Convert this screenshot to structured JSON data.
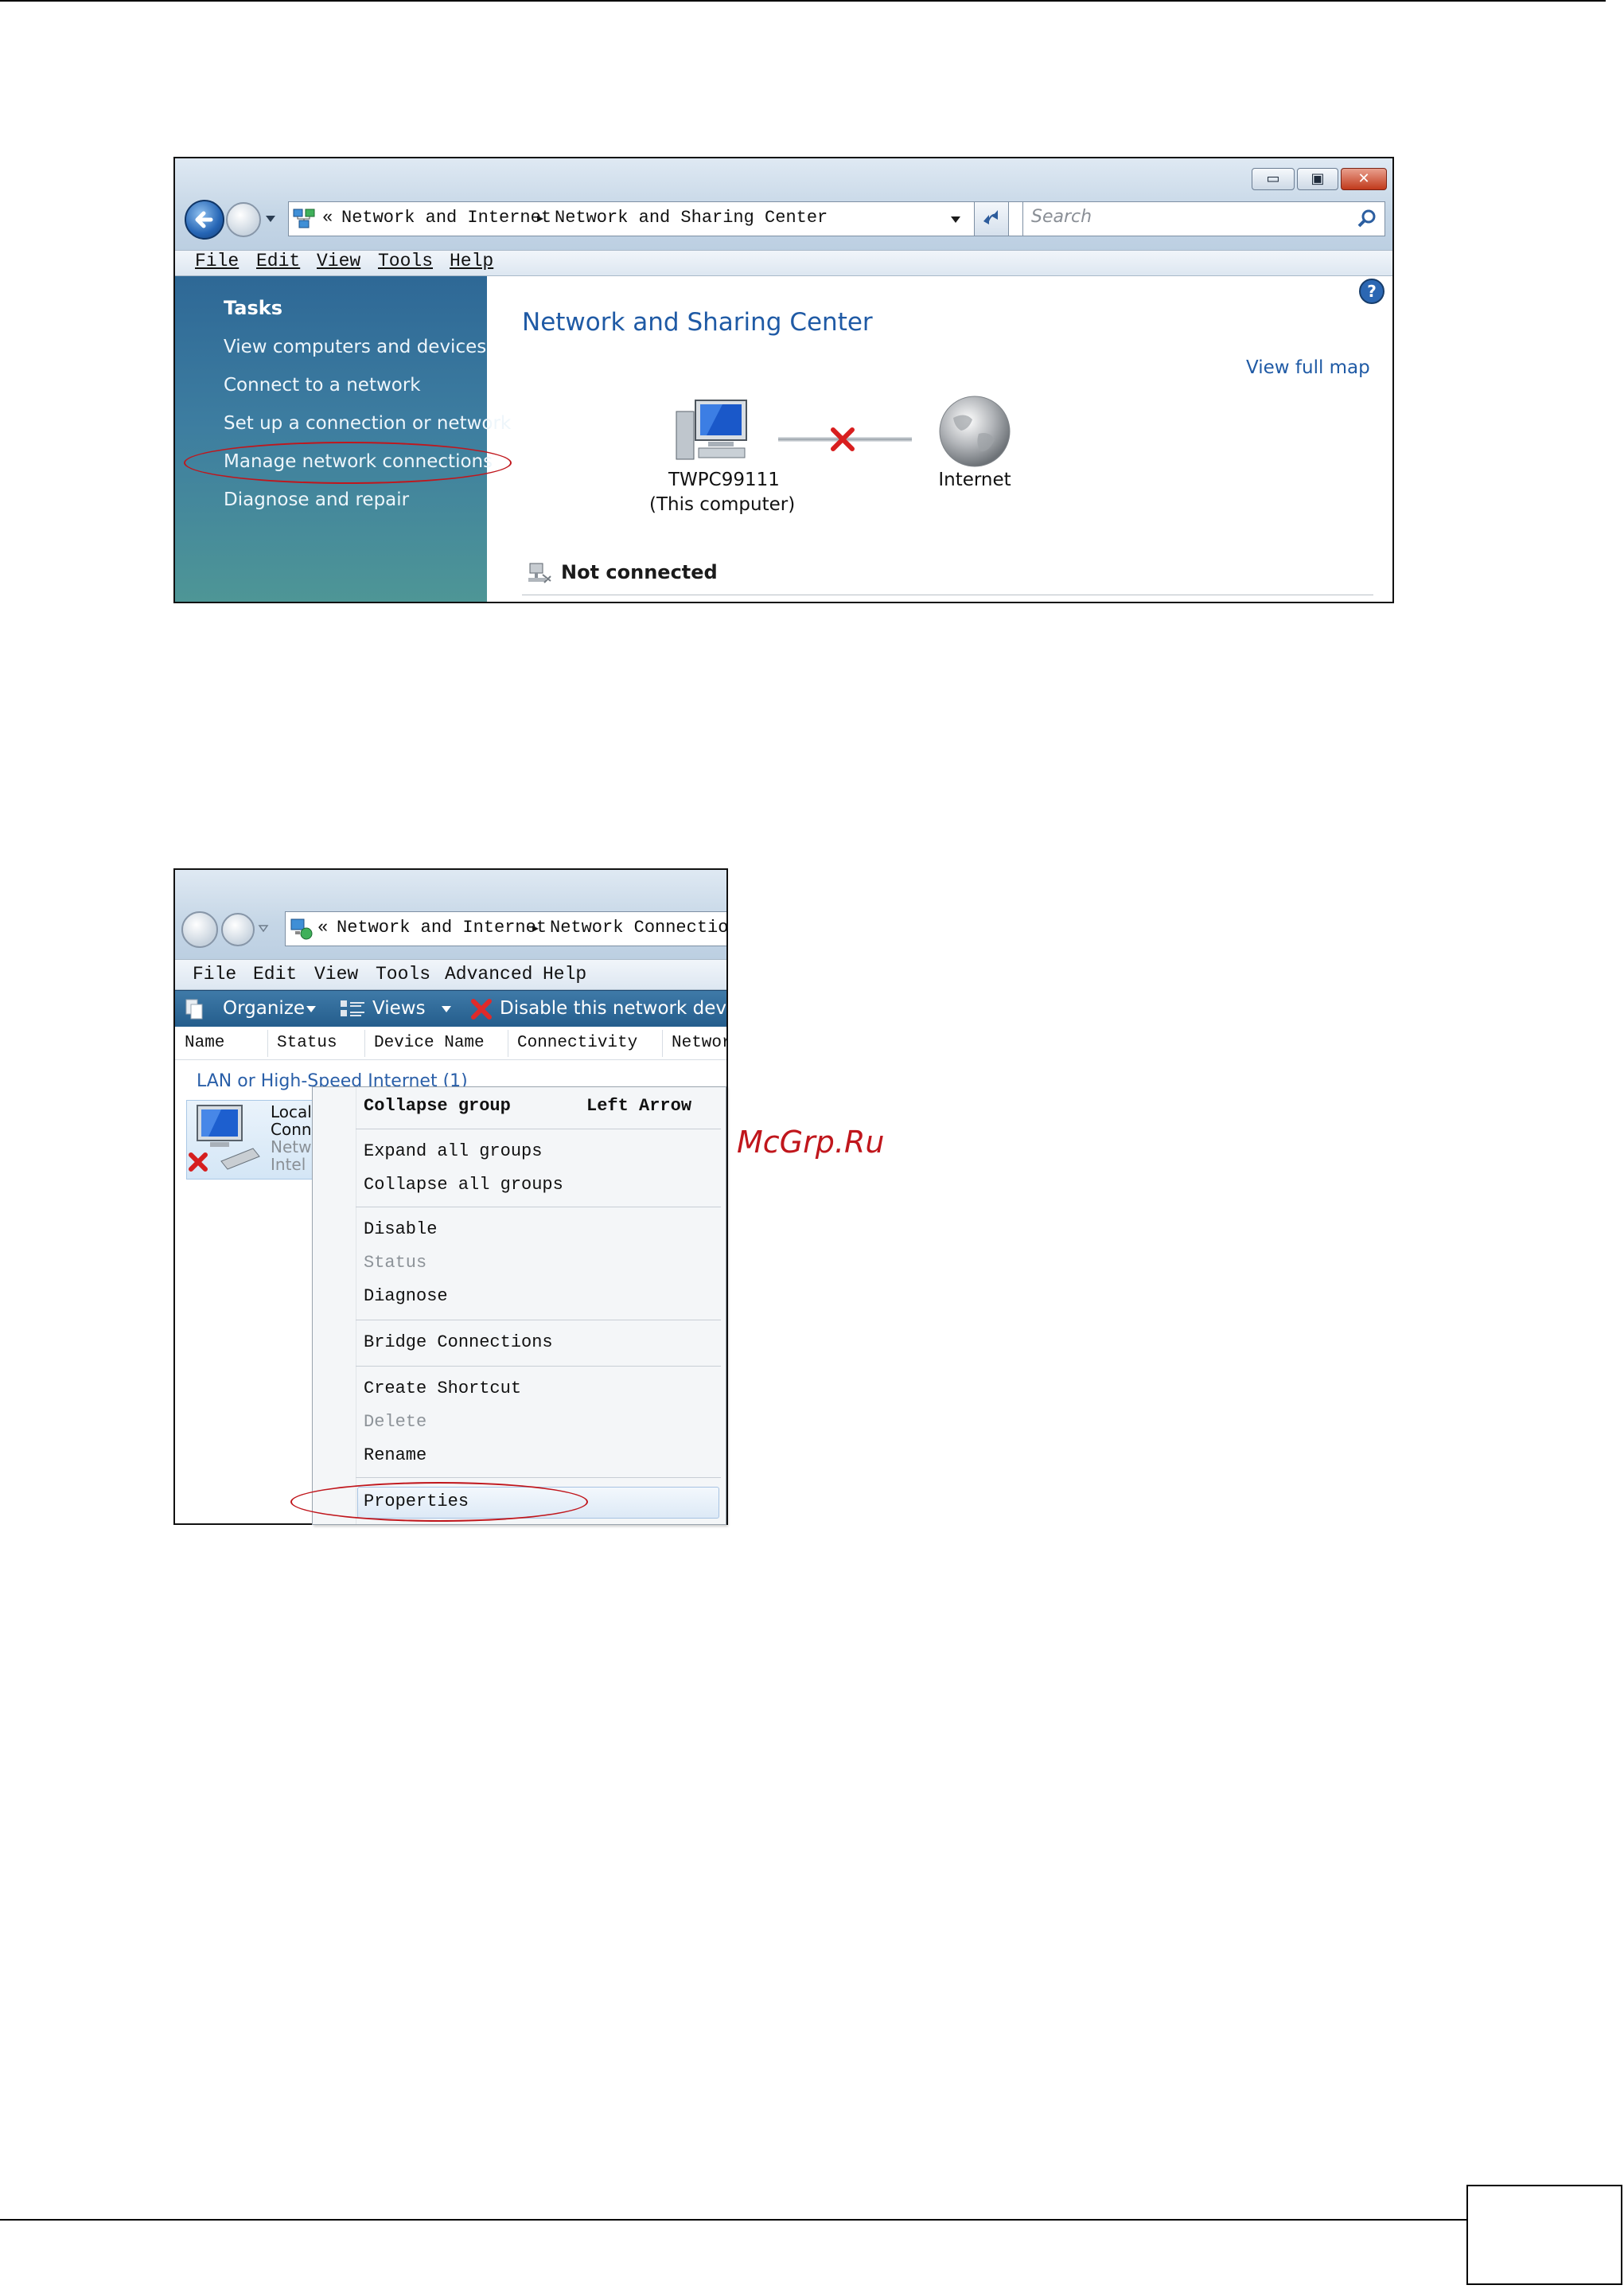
{
  "window1": {
    "address": {
      "prefix": "«",
      "crumb1": "Network and Internet",
      "sep": "▸",
      "crumb2": "Network and Sharing Center"
    },
    "search_placeholder": "Search",
    "menu": [
      "File",
      "Edit",
      "View",
      "Tools",
      "Help"
    ],
    "tasks_heading": "Tasks",
    "tasks": [
      "View computers and devices",
      "Connect to a network",
      "Set up a connection or network",
      "Manage network connections",
      "Diagnose and repair"
    ],
    "page_title": "Network and Sharing Center",
    "view_full_map": "View full map",
    "computer_name": "TWPC99111",
    "computer_sub": "(This computer)",
    "internet_label": "Internet",
    "status": "Not connected"
  },
  "window2": {
    "address": {
      "prefix": "«",
      "crumb1": "Network and Internet",
      "sep": "▸",
      "crumb2": "Network Connections"
    },
    "menu": [
      "File",
      "Edit",
      "View",
      "Tools",
      "Advanced",
      "Help"
    ],
    "toolbar": {
      "organize": "Organize",
      "views": "Views",
      "disable": "Disable this network device"
    },
    "columns": [
      "Name",
      "Status",
      "Device Name",
      "Connectivity",
      "Network"
    ],
    "group": "LAN or High-Speed Internet (1)",
    "item_lines": [
      "Local",
      "Conne",
      "Netwo",
      "Intel"
    ]
  },
  "context_menu": {
    "collapse_group": "Collapse group",
    "collapse_shortcut": "Left Arrow",
    "expand_all": "Expand all groups",
    "collapse_all": "Collapse all groups",
    "disable": "Disable",
    "status": "Status",
    "diagnose": "Diagnose",
    "bridge": "Bridge Connections",
    "create_shortcut": "Create Shortcut",
    "delete": "Delete",
    "rename": "Rename",
    "properties": "Properties"
  },
  "watermark": "McGrp.Ru",
  "colors": {
    "annotation_red": "#c0161c",
    "sidebar_blue": "#2e6896",
    "link_blue": "#1f5aa5",
    "toolbar_blue": "#245d8c"
  }
}
